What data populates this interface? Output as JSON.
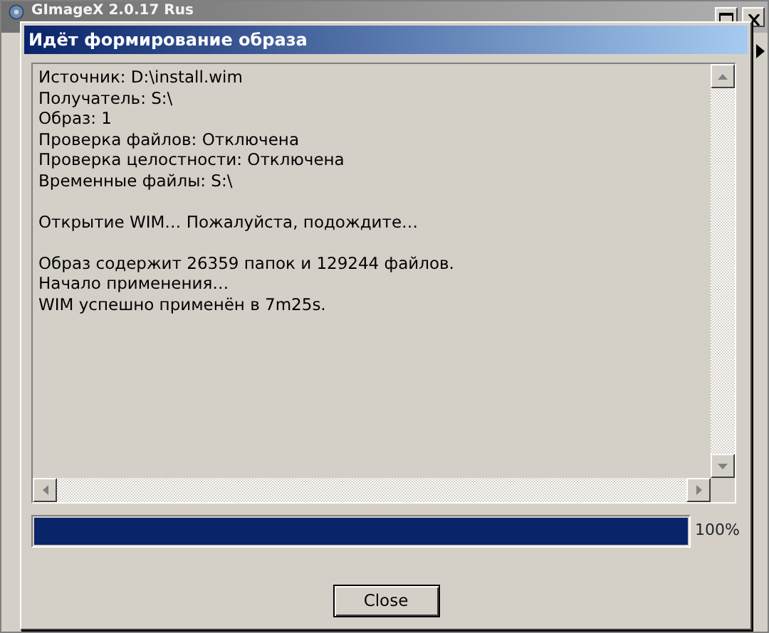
{
  "background_window": {
    "title": "GImageX 2.0.17 Rus"
  },
  "dialog": {
    "title": "Идёт формирование образа",
    "log_blocks": [
      [
        "Источник: D:\\install.wim",
        "Получатель: S:\\",
        "Образ: 1",
        "Проверка файлов: Отключена",
        "Проверка целостности: Отключена",
        "Временные файлы: S:\\"
      ],
      [
        "Открытие WIM… Пожалуйста, подождите…"
      ],
      [
        "Образ содержит 26359 папок и 129244 файлов.",
        "Начало применения…",
        "WIM успешно применён в 7m25s."
      ]
    ],
    "progress": {
      "level": 1.0,
      "reading": "100%"
    },
    "buttons": [
      "Close"
    ]
  }
}
